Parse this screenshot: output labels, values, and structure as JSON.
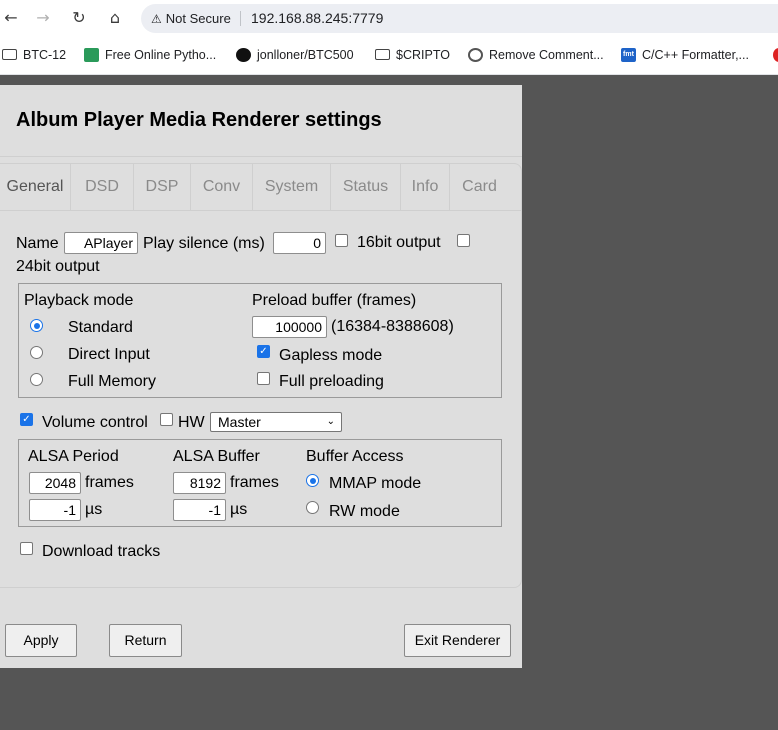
{
  "browser": {
    "security_label": "Not Secure",
    "url": "192.168.88.245:7779",
    "bookmarks": [
      {
        "label": "BTC-12",
        "icon": "folder-icon"
      },
      {
        "label": "Free Online Pytho...",
        "icon": "python-icon"
      },
      {
        "label": "jonlloner/BTC500",
        "icon": "github-icon"
      },
      {
        "label": "$CRIPTO",
        "icon": "folder-icon"
      },
      {
        "label": "Remove Comment...",
        "icon": "globe-icon"
      },
      {
        "label": "C/C++ Formatter,...",
        "icon": "fmt-icon"
      }
    ]
  },
  "page": {
    "title": "Album Player Media Renderer settings",
    "tabs": [
      "General",
      "DSD",
      "DSP",
      "Conv",
      "System",
      "Status",
      "Info",
      "Card"
    ],
    "active_tab": "General"
  },
  "general": {
    "name_label": "Name",
    "name_value": "APlayer",
    "silence_label": "Play silence (ms)",
    "silence_value": "0",
    "out16_label": "16bit output",
    "out16_checked": false,
    "out24_label": "24bit output",
    "out24_checked": false,
    "playback": {
      "title": "Playback mode",
      "options": [
        "Standard",
        "Direct Input",
        "Full Memory"
      ],
      "selected": "Standard"
    },
    "preload": {
      "title": "Preload buffer (frames)",
      "value": "100000",
      "range": "(16384-8388608)",
      "gapless_label": "Gapless mode",
      "gapless_checked": true,
      "full_label": "Full preloading",
      "full_checked": false
    },
    "volume_label": "Volume control",
    "volume_checked": true,
    "hw_label": "HW",
    "hw_checked": false,
    "mixer_selected": "Master",
    "alsa": {
      "period_title": "ALSA Period",
      "period_frames": "2048",
      "period_us": "-1",
      "buffer_title": "ALSA Buffer",
      "buffer_frames": "8192",
      "buffer_us": "-1",
      "frames_unit": "frames",
      "us_unit": "µs",
      "access_title": "Buffer Access",
      "access_options": [
        "MMAP mode",
        "RW mode"
      ],
      "access_selected": "MMAP mode"
    },
    "download_label": "Download tracks",
    "download_checked": false
  },
  "buttons": {
    "apply": "Apply",
    "return": "Return",
    "exit": "Exit Renderer"
  },
  "colors": {
    "accent": "#1a73e8",
    "backdrop": "#555555",
    "panel": "#dedede"
  }
}
